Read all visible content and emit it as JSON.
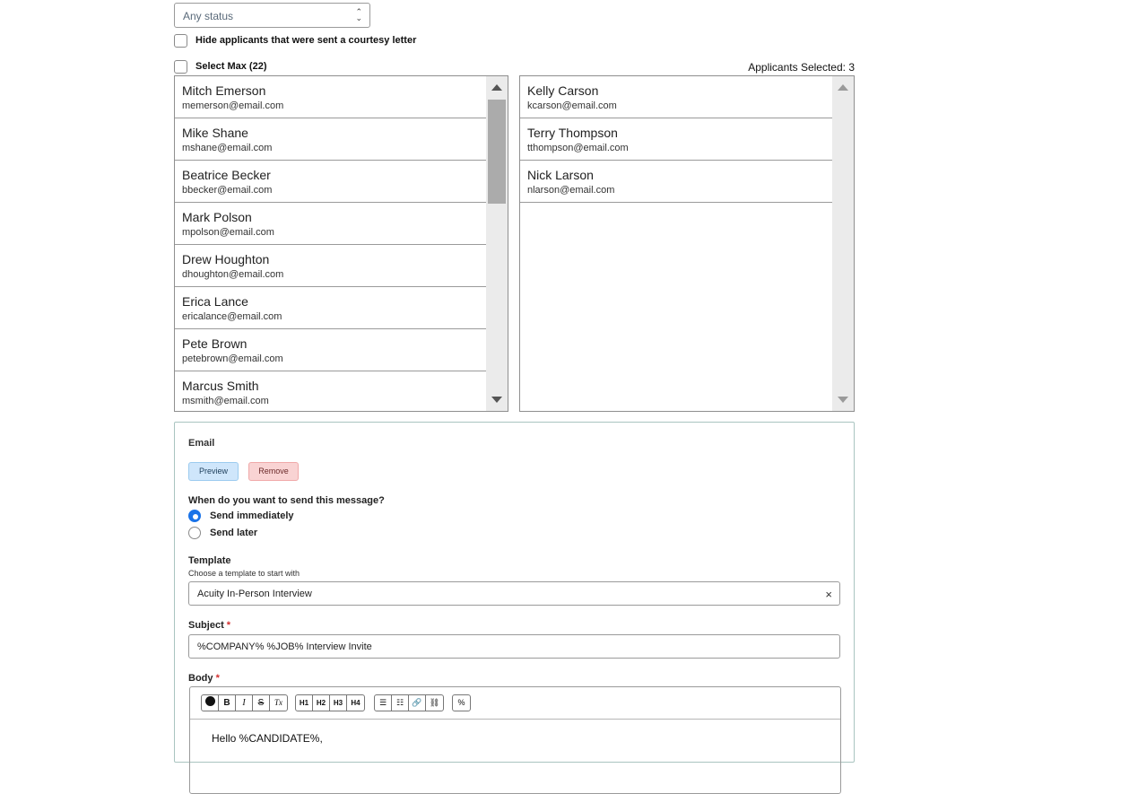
{
  "filters": {
    "status_select": "Any status",
    "hide_courtesy_label": "Hide applicants that were sent a courtesy letter",
    "select_max_label": "Select Max (22)",
    "applicants_selected": "Applicants Selected: 3"
  },
  "available_applicants": [
    {
      "name": "Mitch Emerson",
      "email": "memerson@email.com"
    },
    {
      "name": "Mike Shane",
      "email": "mshane@email.com"
    },
    {
      "name": "Beatrice Becker",
      "email": "bbecker@email.com"
    },
    {
      "name": "Mark Polson",
      "email": "mpolson@email.com"
    },
    {
      "name": "Drew Houghton",
      "email": "dhoughton@email.com"
    },
    {
      "name": "Erica Lance",
      "email": "ericalance@email.com"
    },
    {
      "name": "Pete Brown",
      "email": "petebrown@email.com"
    },
    {
      "name": "Marcus Smith",
      "email": "msmith@email.com"
    }
  ],
  "selected_applicants": [
    {
      "name": "Kelly Carson",
      "email": "kcarson@email.com"
    },
    {
      "name": "Terry Thompson",
      "email": "tthompson@email.com"
    },
    {
      "name": "Nick Larson",
      "email": "nlarson@email.com"
    }
  ],
  "email": {
    "title": "Email",
    "preview_label": "Preview",
    "remove_label": "Remove",
    "send_question": "When do you want to send this message?",
    "send_immediately": "Send immediately",
    "send_later": "Send later",
    "template_label": "Template",
    "template_helper": "Choose a template to start with",
    "template_value": "Acuity In-Person Interview",
    "subject_label": "Subject",
    "subject_value": "%COMPANY% %JOB% Interview Invite",
    "body_label": "Body",
    "required_mark": "*",
    "body_text": "Hello %CANDIDATE%,",
    "clear_glyph": "×",
    "toolbar": {
      "bold": "B",
      "italic": "I",
      "strike": "S",
      "clear_format": "Tx",
      "h1": "H1",
      "h2": "H2",
      "h3": "H3",
      "h4": "H4",
      "bullet": "☰",
      "numbered": "☷",
      "link": "🔗",
      "unlink": "⛓",
      "variable": "%"
    }
  }
}
